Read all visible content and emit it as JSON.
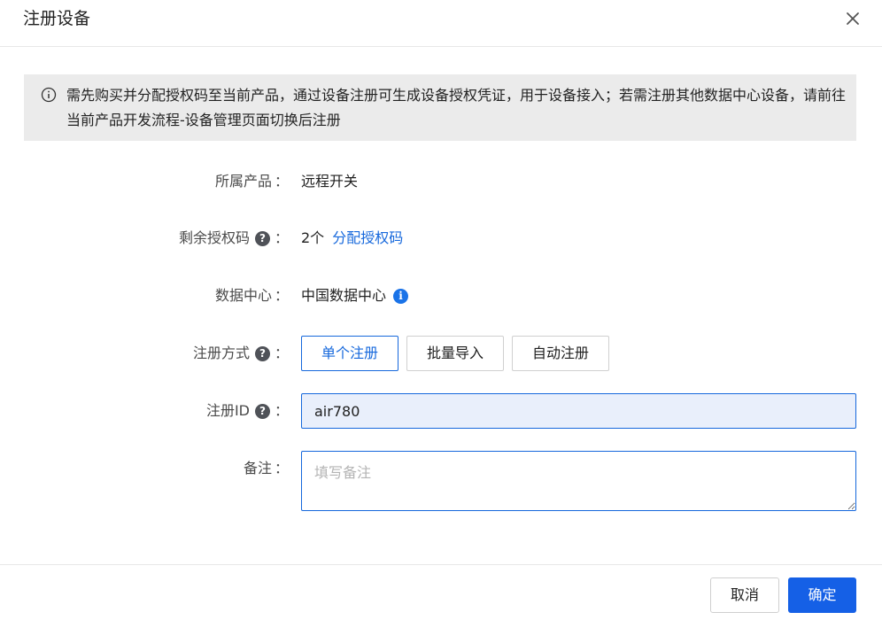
{
  "dialog": {
    "title": "注册设备",
    "close_icon": "close-icon"
  },
  "notice": {
    "icon": "info-circle-icon",
    "text": "需先购买并分配授权码至当前产品，通过设备注册可生成设备授权凭证，用于设备接入；若需注册其他数据中心设备，请前往当前产品开发流程-设备管理页面切换后注册"
  },
  "form": {
    "product": {
      "label": "所属产品",
      "colon": "：",
      "value": "远程开关"
    },
    "license": {
      "label": "剩余授权码",
      "colon": "：",
      "help": "?",
      "count": "2个",
      "link": "分配授权码"
    },
    "datacenter": {
      "label": "数据中心",
      "colon": "：",
      "value": "中国数据中心",
      "info": "i"
    },
    "mode": {
      "label": "注册方式",
      "colon": "：",
      "help": "?",
      "options": [
        "单个注册",
        "批量导入",
        "自动注册"
      ],
      "selected": "单个注册"
    },
    "register_id": {
      "label": "注册ID",
      "colon": "：",
      "help": "?",
      "value": "air780"
    },
    "remark": {
      "label": "备注",
      "colon": "：",
      "placeholder": "填写备注",
      "value": ""
    }
  },
  "footer": {
    "cancel_label": "取消",
    "ok_label": "确定"
  },
  "colors": {
    "primary": "#1560e6",
    "link": "#1668dc",
    "notice_bg": "#ebebeb",
    "input_bg": "#e9effb"
  }
}
